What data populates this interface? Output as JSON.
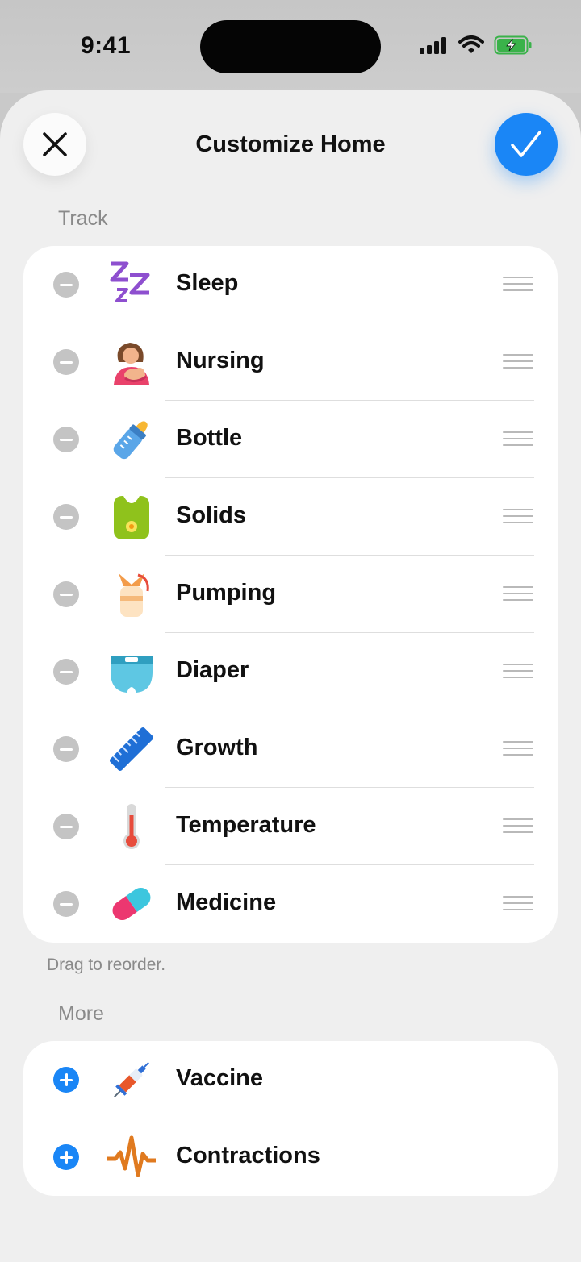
{
  "status": {
    "time": "9:41"
  },
  "header": {
    "title": "Customize Home"
  },
  "track": {
    "label": "Track",
    "items": [
      {
        "label": "Sleep",
        "icon": "sleep-icon"
      },
      {
        "label": "Nursing",
        "icon": "nursing-icon"
      },
      {
        "label": "Bottle",
        "icon": "bottle-icon"
      },
      {
        "label": "Solids",
        "icon": "bib-icon"
      },
      {
        "label": "Pumping",
        "icon": "breast-pump-icon"
      },
      {
        "label": "Diaper",
        "icon": "diaper-icon"
      },
      {
        "label": "Growth",
        "icon": "ruler-icon"
      },
      {
        "label": "Temperature",
        "icon": "thermometer-icon"
      },
      {
        "label": "Medicine",
        "icon": "pill-icon"
      }
    ]
  },
  "footer_note": "Drag to reorder.",
  "more": {
    "label": "More",
    "items": [
      {
        "label": "Vaccine",
        "icon": "syringe-icon"
      },
      {
        "label": "Contractions",
        "icon": "pulse-icon"
      }
    ]
  },
  "colors": {
    "accent": "#1a86f6",
    "remove": "#c4c4c4",
    "background": "#efefef"
  }
}
